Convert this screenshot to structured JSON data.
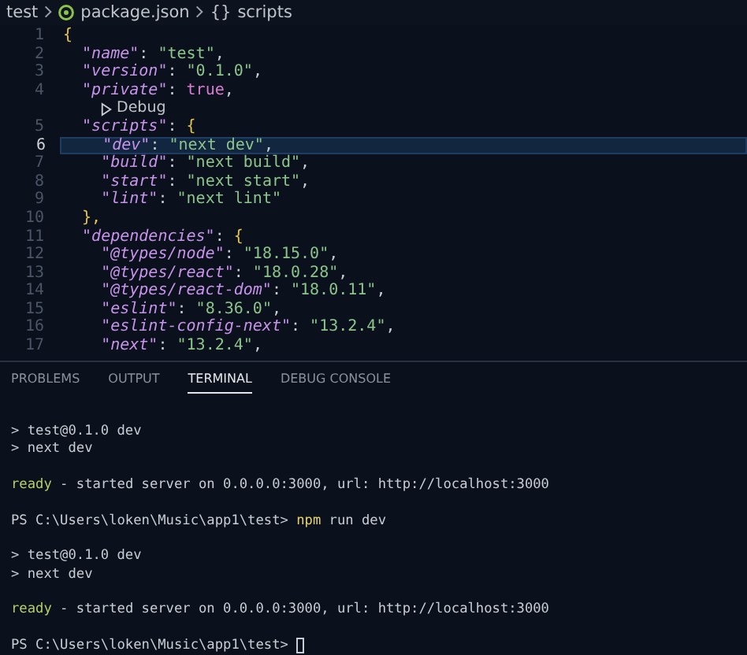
{
  "breadcrumb": {
    "items": [
      {
        "label": "test",
        "kind": "folder"
      },
      {
        "label": "package.json",
        "kind": "file"
      },
      {
        "label": "scripts",
        "kind": "symbol",
        "glyph": "{}"
      }
    ]
  },
  "editor": {
    "lines": [
      {
        "number": "1",
        "selected": false,
        "tokens": [
          {
            "t": "{",
            "kind": "brace"
          }
        ]
      },
      {
        "number": "2",
        "selected": false,
        "tokens": [
          {
            "t": "  \"name\"",
            "kind": "key"
          },
          {
            "t": ": ",
            "kind": "punct"
          },
          {
            "t": "\"test\"",
            "kind": "string"
          },
          {
            "t": ",",
            "kind": "punct"
          }
        ]
      },
      {
        "number": "3",
        "selected": false,
        "tokens": [
          {
            "t": "  \"version\"",
            "kind": "key"
          },
          {
            "t": ": ",
            "kind": "punct"
          },
          {
            "t": "\"0.1.0\"",
            "kind": "string"
          },
          {
            "t": ",",
            "kind": "punct"
          }
        ]
      },
      {
        "number": "4",
        "selected": false,
        "tokens": [
          {
            "t": "  \"private\"",
            "kind": "key"
          },
          {
            "t": ": ",
            "kind": "punct"
          },
          {
            "t": "true",
            "kind": "keyword"
          },
          {
            "t": ",",
            "kind": "punct"
          }
        ],
        "lens": "Debug"
      },
      {
        "number": "5",
        "selected": false,
        "tokens": [
          {
            "t": "  \"scripts\"",
            "kind": "key"
          },
          {
            "t": ": ",
            "kind": "punct"
          },
          {
            "t": "{",
            "kind": "brace"
          }
        ]
      },
      {
        "number": "6",
        "selected": true,
        "tokens": [
          {
            "t": "    \"dev\"",
            "kind": "key"
          },
          {
            "t": ": ",
            "kind": "punct"
          },
          {
            "t": "\"next dev\"",
            "kind": "string"
          },
          {
            "t": ",",
            "kind": "punct"
          }
        ]
      },
      {
        "number": "7",
        "selected": false,
        "tokens": [
          {
            "t": "    \"build\"",
            "kind": "key"
          },
          {
            "t": ": ",
            "kind": "punct"
          },
          {
            "t": "\"next build\"",
            "kind": "string"
          },
          {
            "t": ",",
            "kind": "punct"
          }
        ]
      },
      {
        "number": "8",
        "selected": false,
        "tokens": [
          {
            "t": "    \"start\"",
            "kind": "key"
          },
          {
            "t": ": ",
            "kind": "punct"
          },
          {
            "t": "\"next start\"",
            "kind": "string"
          },
          {
            "t": ",",
            "kind": "punct"
          }
        ]
      },
      {
        "number": "9",
        "selected": false,
        "tokens": [
          {
            "t": "    \"lint\"",
            "kind": "key"
          },
          {
            "t": ": ",
            "kind": "punct"
          },
          {
            "t": "\"next lint\"",
            "kind": "string"
          }
        ]
      },
      {
        "number": "10",
        "selected": false,
        "tokens": [
          {
            "t": "  },",
            "kind": "brace"
          }
        ]
      },
      {
        "number": "11",
        "selected": false,
        "tokens": [
          {
            "t": "  \"dependencies\"",
            "kind": "key"
          },
          {
            "t": ": ",
            "kind": "punct"
          },
          {
            "t": "{",
            "kind": "brace"
          }
        ]
      },
      {
        "number": "12",
        "selected": false,
        "tokens": [
          {
            "t": "    \"@types/node\"",
            "kind": "key"
          },
          {
            "t": ": ",
            "kind": "punct"
          },
          {
            "t": "\"18.15.0\"",
            "kind": "string"
          },
          {
            "t": ",",
            "kind": "punct"
          }
        ]
      },
      {
        "number": "13",
        "selected": false,
        "tokens": [
          {
            "t": "    \"@types/react\"",
            "kind": "key"
          },
          {
            "t": ": ",
            "kind": "punct"
          },
          {
            "t": "\"18.0.28\"",
            "kind": "string"
          },
          {
            "t": ",",
            "kind": "punct"
          }
        ]
      },
      {
        "number": "14",
        "selected": false,
        "tokens": [
          {
            "t": "    \"@types/react-dom\"",
            "kind": "key"
          },
          {
            "t": ": ",
            "kind": "punct"
          },
          {
            "t": "\"18.0.11\"",
            "kind": "string"
          },
          {
            "t": ",",
            "kind": "punct"
          }
        ]
      },
      {
        "number": "15",
        "selected": false,
        "tokens": [
          {
            "t": "    \"eslint\"",
            "kind": "key"
          },
          {
            "t": ": ",
            "kind": "punct"
          },
          {
            "t": "\"8.36.0\"",
            "kind": "string"
          },
          {
            "t": ",",
            "kind": "punct"
          }
        ]
      },
      {
        "number": "16",
        "selected": false,
        "tokens": [
          {
            "t": "    \"eslint-config-next\"",
            "kind": "key"
          },
          {
            "t": ": ",
            "kind": "punct"
          },
          {
            "t": "\"13.2.4\"",
            "kind": "string"
          },
          {
            "t": ",",
            "kind": "punct"
          }
        ]
      },
      {
        "number": "17",
        "selected": false,
        "tokens": [
          {
            "t": "    \"next\"",
            "kind": "key"
          },
          {
            "t": ": ",
            "kind": "punct"
          },
          {
            "t": "\"13.2.4\"",
            "kind": "string"
          },
          {
            "t": ",",
            "kind": "punct"
          }
        ]
      }
    ]
  },
  "panel": {
    "tabs": [
      {
        "label": "PROBLEMS",
        "selected": false
      },
      {
        "label": "OUTPUT",
        "selected": false
      },
      {
        "label": "TERMINAL",
        "selected": true
      },
      {
        "label": "DEBUG CONSOLE",
        "selected": false
      }
    ],
    "terminal": {
      "lines": [
        {
          "kind": "blank"
        },
        {
          "kind": "text",
          "tokens": [
            {
              "t": "> test@0.1.0 dev",
              "kind": "plain"
            }
          ]
        },
        {
          "kind": "text",
          "tokens": [
            {
              "t": "> next dev",
              "kind": "plain"
            }
          ]
        },
        {
          "kind": "blank"
        },
        {
          "kind": "text",
          "tokens": [
            {
              "t": "ready",
              "kind": "ready"
            },
            {
              "t": " - started server on 0.0.0.0:3000, url: http://localhost:3000",
              "kind": "plain"
            }
          ]
        },
        {
          "kind": "blank"
        },
        {
          "kind": "text",
          "tokens": [
            {
              "t": "PS C:\\Users\\loken\\Music\\app1\\test> ",
              "kind": "plain"
            },
            {
              "t": "npm",
              "kind": "command"
            },
            {
              "t": " run dev",
              "kind": "plain"
            }
          ]
        },
        {
          "kind": "blank"
        },
        {
          "kind": "text",
          "tokens": [
            {
              "t": "> test@0.1.0 dev",
              "kind": "plain"
            }
          ]
        },
        {
          "kind": "text",
          "tokens": [
            {
              "t": "> next dev",
              "kind": "plain"
            }
          ]
        },
        {
          "kind": "blank"
        },
        {
          "kind": "text",
          "tokens": [
            {
              "t": "ready",
              "kind": "ready"
            },
            {
              "t": " - started server on 0.0.0.0:3000, url: http://localhost:3000",
              "kind": "plain"
            }
          ]
        },
        {
          "kind": "blank"
        },
        {
          "kind": "text",
          "cursor": true,
          "tokens": [
            {
              "t": "PS C:\\Users\\loken\\Music\\app1\\test> ",
              "kind": "plain"
            }
          ]
        }
      ]
    }
  }
}
